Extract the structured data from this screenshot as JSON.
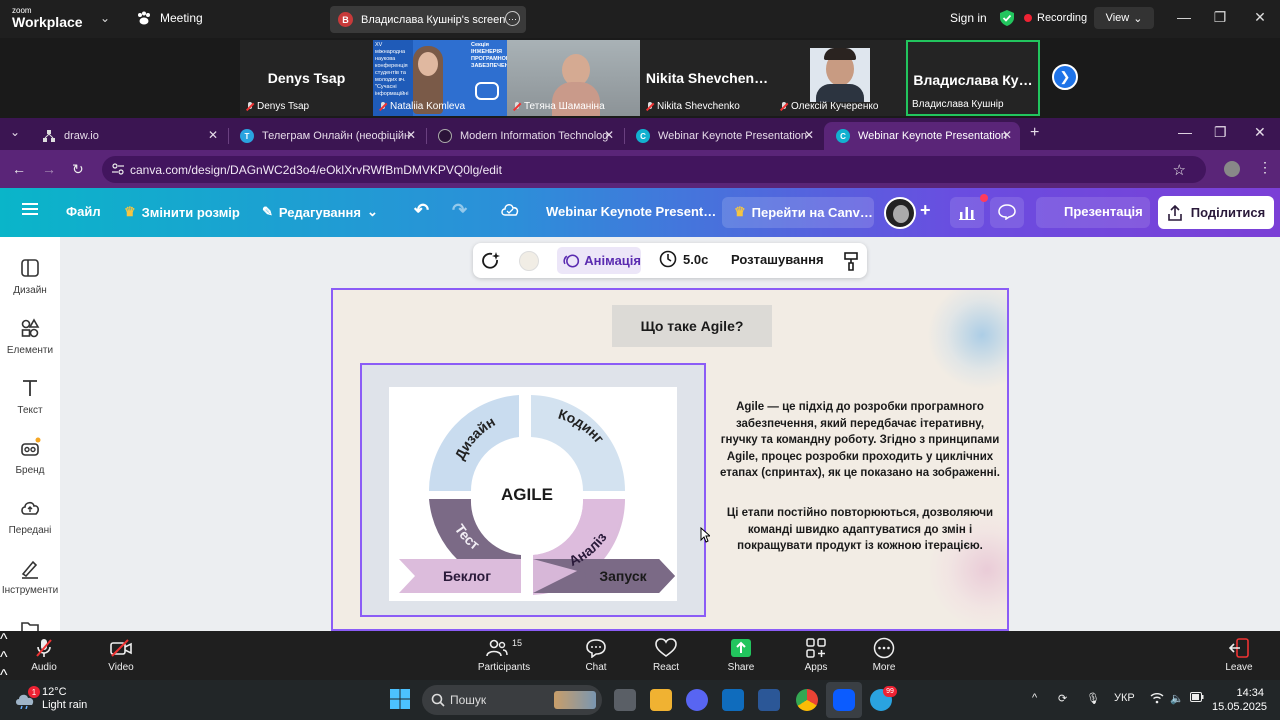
{
  "zoom": {
    "logo_top": "zoom",
    "logo_bottom": "Workplace",
    "meeting_label": "Meeting",
    "screen_share_avatar": "B",
    "screen_share_label": "Владислава Кушнір's screen",
    "sign_in": "Sign in",
    "recording": "Recording",
    "view": "View",
    "participants": [
      {
        "big_name": "Denys Tsap",
        "tag": "Denys Tsap"
      },
      {
        "big_name": "",
        "tag": "Nataliia Komleva"
      },
      {
        "big_name": "",
        "tag": "Тетяна Шаманіна"
      },
      {
        "big_name": "Nikita  Shevchen…",
        "tag": "Nikita Shevchenko"
      },
      {
        "big_name": "",
        "tag": "Олексій Кучеренко"
      },
      {
        "big_name": "Владислава  Ку…",
        "tag": "Владислава Кушнір"
      }
    ],
    "poster_text": [
      "XV міжнародна",
      "наукова",
      "конференція",
      "студентів та",
      "молодих вч.",
      "\"Сучасні",
      "інформаційні"
    ],
    "poster_title": [
      "Секція",
      "ІНЖЕНЕРІЯ",
      "ПРОГРАМНОГО",
      "ЗАБЕЗПЕЧЕННЯ»"
    ],
    "toolbar": {
      "audio": "Audio",
      "video": "Video",
      "participants": "Participants",
      "participants_count": "15",
      "chat": "Chat",
      "react": "React",
      "share": "Share",
      "apps": "Apps",
      "more": "More",
      "leave": "Leave"
    }
  },
  "browser": {
    "tabs": [
      {
        "title": "draw.io",
        "icon": "drawio-icon"
      },
      {
        "title": "Телеграм Онлайн (неофіційн",
        "icon": "telegram-icon"
      },
      {
        "title": "Modern Information Technolog",
        "icon": "github-icon"
      },
      {
        "title": "Webinar Keynote Presentation",
        "icon": "canva-icon"
      },
      {
        "title": "Webinar Keynote Presentation",
        "icon": "canva-icon"
      }
    ],
    "url": "canva.com/design/DAGnWC2d3o4/eOklXrvRWfBmDMVKPVQ0lg/edit"
  },
  "canva": {
    "menu_file": "Файл",
    "resize": "Змінити розмір",
    "editing": "Редагування",
    "doc_title": "Webinar Keynote Present…",
    "upgrade": "Перейти на Canv…",
    "present": "Презентація",
    "share": "Поділитися",
    "sidebar": [
      "Дизайн",
      "Елементи",
      "Текст",
      "Бренд",
      "Передані",
      "Інструменти"
    ],
    "ctx": {
      "animation": "Анімація",
      "duration": "5.0с",
      "position": "Розташування"
    },
    "slide": {
      "title": "Що таке Agile?",
      "diagram": {
        "center": "AGILE",
        "design": "Дизайн",
        "coding": "Кодинг",
        "test": "Тест",
        "analysis": "Аналіз",
        "backlog": "Беклог",
        "launch": "Запуск"
      },
      "paragraph1": "Agile — це підхід до розробки програмного забезпечення, який передбачає ітеративну, гнучку та командну роботу. Згідно з принципами Agile, процес розробки проходить у циклічних етапах (спринтах), як це показано на зображенні.",
      "paragraph2": "Ці етапи постійно повторюються, дозволяючи команді швидко адаптуватися до змін і покращувати продукт із кожною ітерацією."
    }
  },
  "taskbar": {
    "temperature": "12°C",
    "weather": "Light rain",
    "weather_badge": "1",
    "search": "Пошук",
    "telegram_badge": "99",
    "language": "УКР",
    "time": "14:34",
    "date": "15.05.2025"
  },
  "colors": {
    "zoom_bg": "#1f1f1f",
    "browser_tabs": "#3b1552",
    "browser_bar": "#5a2578",
    "canva_accent": "#8b5cf6",
    "active_tile": "#22c55e",
    "agile_blue": "#c9dcef",
    "agile_purple": "#7b6a86",
    "agile_pink": "#d8b9d8"
  }
}
